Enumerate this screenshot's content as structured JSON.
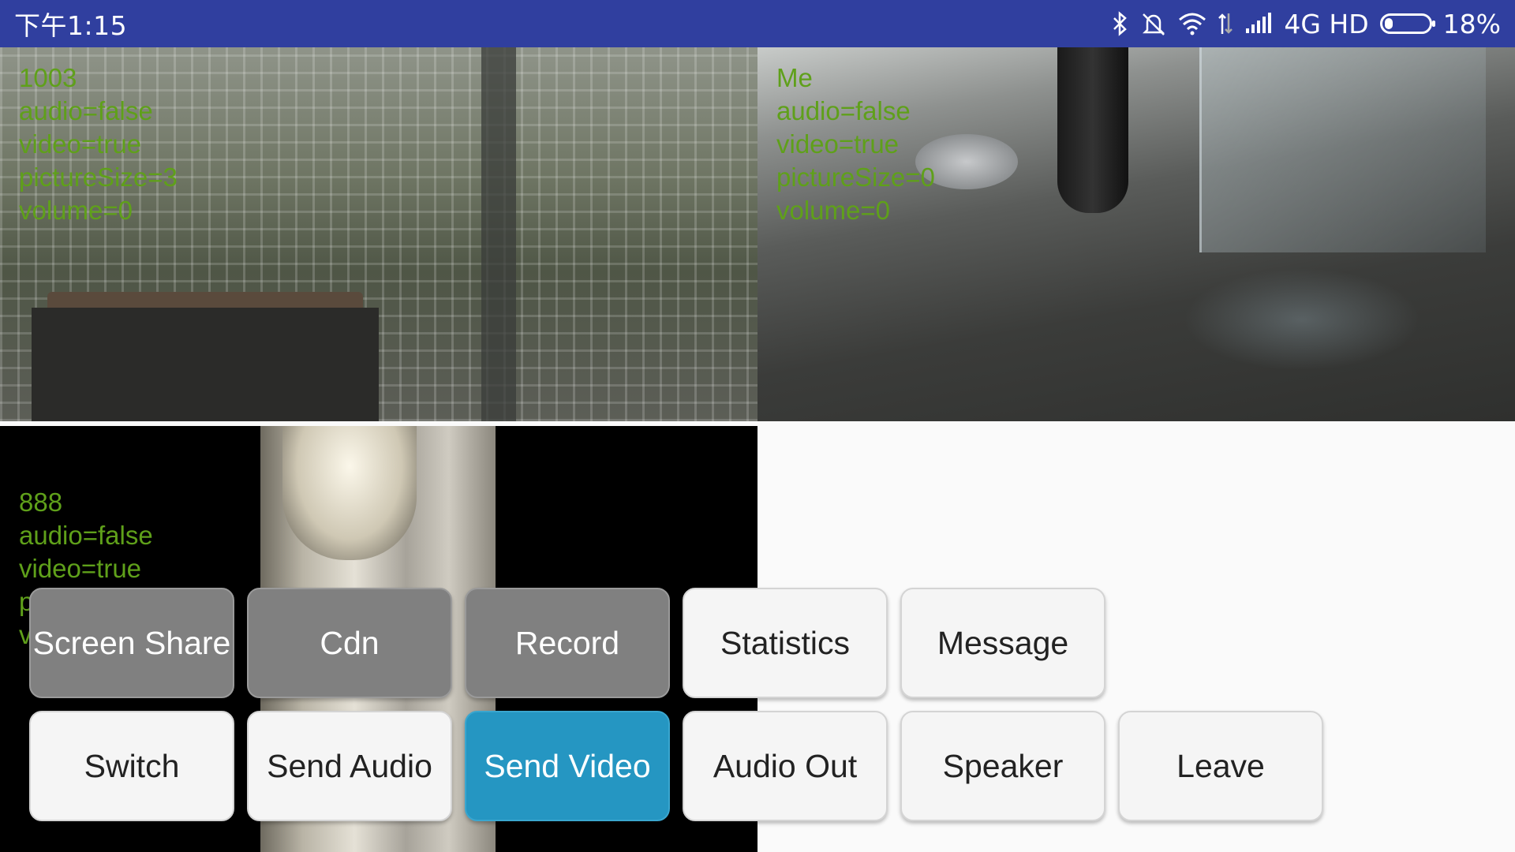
{
  "status_bar": {
    "time": "下午1:15",
    "network": "4G HD",
    "battery": "18%",
    "battery_level": 0.18,
    "icons": [
      "bluetooth-icon",
      "mute-icon",
      "wifi-icon",
      "data-arrows-icon",
      "signal-icon",
      "battery-icon"
    ]
  },
  "tiles": {
    "remote1": {
      "lines": [
        "1003",
        "audio=false",
        "video=true",
        "pictureSize=3",
        "volume=0"
      ]
    },
    "me": {
      "lines": [
        "Me",
        "audio=false",
        "video=true",
        "pictureSize=0",
        "volume=0"
      ]
    },
    "remote2": {
      "lines": [
        "888",
        "audio=false",
        "video=true",
        "p",
        "v"
      ]
    }
  },
  "buttons": {
    "screen_share": "Screen Share",
    "cdn": "Cdn",
    "record": "Record",
    "statistics": "Statistics",
    "message": "Message",
    "switch": "Switch",
    "send_audio": "Send Audio",
    "send_video": "Send Video",
    "audio_out": "Audio Out",
    "speaker": "Speaker",
    "leave": "Leave"
  },
  "colors": {
    "status_bar": "#303f9f",
    "overlay_text": "#5fa01a",
    "active_button": "#2596c2",
    "disabled_button": "#808080"
  }
}
